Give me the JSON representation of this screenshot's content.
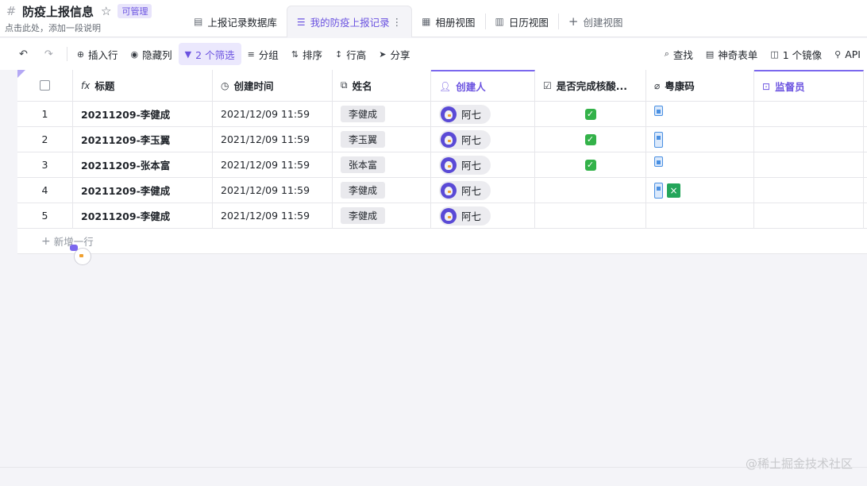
{
  "header": {
    "title": "防疫上报信息",
    "badge": "可管理",
    "subtitle": "点击此处，添加一段说明"
  },
  "tabs": [
    {
      "label": "上报记录数据库",
      "icon": "table-icon"
    },
    {
      "label": "我的防疫上报记录",
      "icon": "list-icon",
      "active": true
    },
    {
      "label": "相册视图",
      "icon": "gallery-icon"
    },
    {
      "label": "日历视图",
      "icon": "calendar-icon"
    },
    {
      "label": "创建视图",
      "icon": "plus-icon"
    }
  ],
  "toolbar": {
    "insert_row": "插入行",
    "hide_columns": "隐藏列",
    "filter": "2 个筛选",
    "group": "分组",
    "sort": "排序",
    "row_height": "行高",
    "share": "分享",
    "find": "查找",
    "magic_form": "神奇表单",
    "mirror": "1 个镜像",
    "api": "API"
  },
  "columns": {
    "title": "标题",
    "created_time": "创建时间",
    "name": "姓名",
    "creator": "创建人",
    "nucleic": "是否完成核酸...",
    "health_code": "粤康码",
    "supervisor": "监督员"
  },
  "rows": [
    {
      "num": "1",
      "title": "20211209-李健成",
      "time": "2021/12/09 11:59",
      "name": "李健成",
      "creator": "阿七",
      "done": true
    },
    {
      "num": "2",
      "title": "20211209-李玉翼",
      "time": "2021/12/09 11:59",
      "name": "李玉翼",
      "creator": "阿七",
      "done": true
    },
    {
      "num": "3",
      "title": "20211209-张本富",
      "time": "2021/12/09 11:59",
      "name": "张本富",
      "creator": "阿七",
      "done": true
    },
    {
      "num": "4",
      "title": "20211209-李健成",
      "time": "2021/12/09 11:59",
      "name": "李健成",
      "creator": "阿七",
      "done": false
    },
    {
      "num": "5",
      "title": "20211209-李健成",
      "time": "2021/12/09 11:59",
      "name": "李健成",
      "creator": "阿七",
      "done": false
    }
  ],
  "add_row": "新增一行",
  "watermark": "@稀土掘金技术社区"
}
